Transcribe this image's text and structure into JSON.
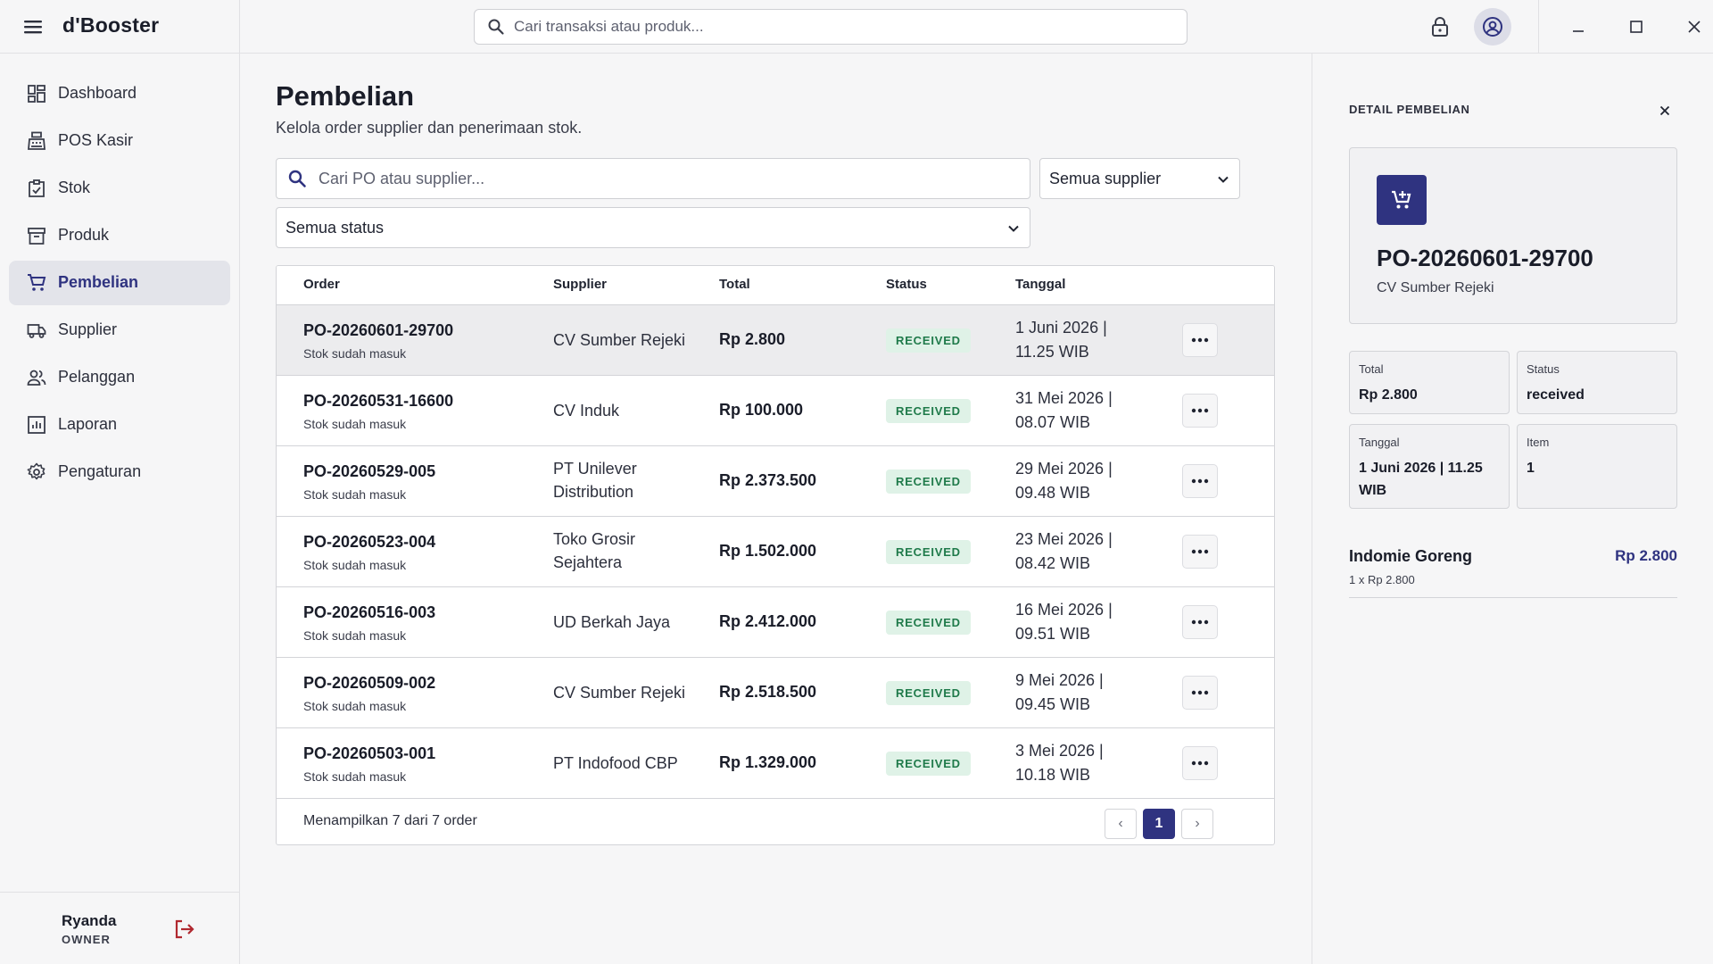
{
  "app": {
    "name": "d'Booster"
  },
  "topbar": {
    "search_placeholder": "Cari transaksi atau produk..."
  },
  "sidebar": {
    "items": [
      {
        "label": "Dashboard",
        "icon": "dashboard-icon"
      },
      {
        "label": "POS Kasir",
        "icon": "cashier-icon"
      },
      {
        "label": "Stok",
        "icon": "stock-icon"
      },
      {
        "label": "Produk",
        "icon": "archive-icon"
      },
      {
        "label": "Pembelian",
        "icon": "cart-icon",
        "active": true
      },
      {
        "label": "Supplier",
        "icon": "truck-icon"
      },
      {
        "label": "Pelanggan",
        "icon": "users-icon"
      },
      {
        "label": "Laporan",
        "icon": "report-icon"
      },
      {
        "label": "Pengaturan",
        "icon": "gear-icon"
      }
    ],
    "user": {
      "name": "Ryanda",
      "role": "OWNER"
    }
  },
  "page": {
    "title": "Pembelian",
    "subtitle": "Kelola order supplier dan penerimaan stok.",
    "search_placeholder": "Cari PO atau supplier...",
    "supplier_filter": "Semua supplier",
    "status_filter": "Semua status"
  },
  "table": {
    "columns": [
      "Order",
      "Supplier",
      "Total",
      "Status",
      "Tanggal"
    ],
    "rows": [
      {
        "order": "PO-20260601-29700",
        "note": "Stok sudah masuk",
        "supplier": "CV Sumber Rejeki",
        "total": "Rp 2.800",
        "status": "RECEIVED",
        "date": "1 Juni 2026 | 11.25 WIB"
      },
      {
        "order": "PO-20260531-16600",
        "note": "Stok sudah masuk",
        "supplier": "CV Induk",
        "total": "Rp 100.000",
        "status": "RECEIVED",
        "date": "31 Mei 2026 | 08.07 WIB"
      },
      {
        "order": "PO-20260529-005",
        "note": "Stok sudah masuk",
        "supplier": "PT Unilever Distribution",
        "total": "Rp 2.373.500",
        "status": "RECEIVED",
        "date": "29 Mei 2026 | 09.48 WIB"
      },
      {
        "order": "PO-20260523-004",
        "note": "Stok sudah masuk",
        "supplier": "Toko Grosir Sejahtera",
        "total": "Rp 1.502.000",
        "status": "RECEIVED",
        "date": "23 Mei 2026 | 08.42 WIB"
      },
      {
        "order": "PO-20260516-003",
        "note": "Stok sudah masuk",
        "supplier": "UD Berkah Jaya",
        "total": "Rp 2.412.000",
        "status": "RECEIVED",
        "date": "16 Mei 2026 | 09.51 WIB"
      },
      {
        "order": "PO-20260509-002",
        "note": "Stok sudah masuk",
        "supplier": "CV Sumber Rejeki",
        "total": "Rp 2.518.500",
        "status": "RECEIVED",
        "date": "9 Mei 2026 | 09.45 WIB"
      },
      {
        "order": "PO-20260503-001",
        "note": "Stok sudah masuk",
        "supplier": "PT Indofood CBP",
        "total": "Rp 1.329.000",
        "status": "RECEIVED",
        "date": "3 Mei 2026 | 10.18 WIB"
      }
    ],
    "footer": "Menampilkan 7 dari 7 order",
    "pagination": {
      "prev": "‹",
      "current": "1",
      "next": "›"
    }
  },
  "detail": {
    "title": "DETAIL PEMBELIAN",
    "po": "PO-20260601-29700",
    "supplier": "CV Sumber Rejeki",
    "stats": {
      "total_label": "Total",
      "total": "Rp 2.800",
      "status_label": "Status",
      "status": "received",
      "date_label": "Tanggal",
      "date": "1 Juni 2026 | 11.25 WIB",
      "item_label": "Item",
      "item": "1"
    },
    "line_items": [
      {
        "name": "Indomie Goreng",
        "qty": "1 x Rp 2.800",
        "price": "Rp 2.800"
      }
    ]
  },
  "colors": {
    "accent": "#2f3380",
    "received_bg": "#dff2e7",
    "received_text": "#1f7a4a",
    "logout": "#b0282f"
  }
}
